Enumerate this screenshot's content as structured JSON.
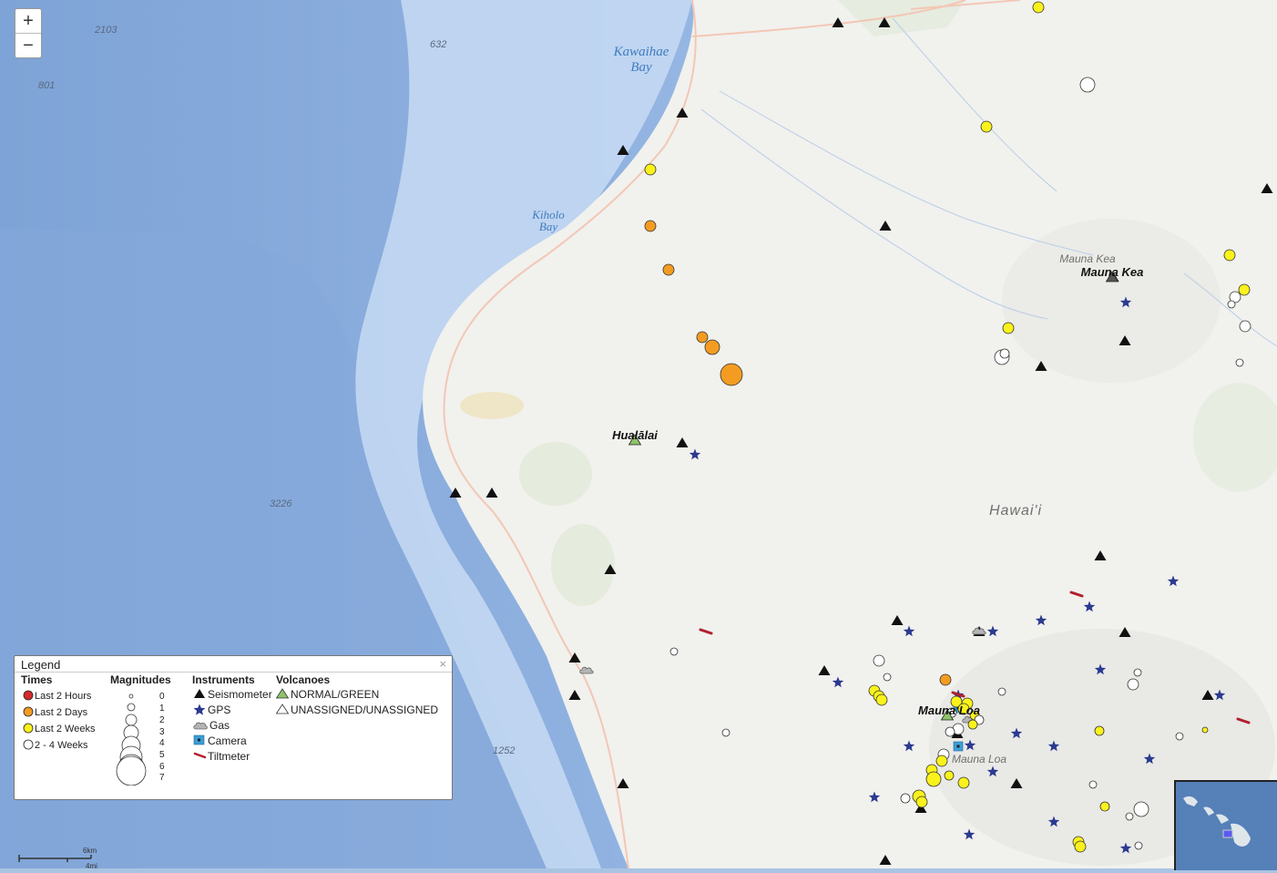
{
  "zoom": {
    "in_label": "+",
    "out_label": "−"
  },
  "labels": {
    "depth": [
      "2103",
      "632",
      "801",
      "3226",
      "1252"
    ],
    "kawaihae": [
      "Kawaihae",
      "Bay"
    ],
    "kiholo": [
      "Kiholo",
      "Bay"
    ],
    "mauna_kea_grey": "Mauna Kea",
    "mauna_kea_black": "Mauna Kea",
    "hualalai": "Hualālai",
    "hawaii": "Hawai'i",
    "mauna_loa_black": "Mauna Loa",
    "mauna_loa_grey": "Mauna Loa"
  },
  "legend": {
    "title": "Legend",
    "close": "×",
    "times_header": "Times",
    "times": [
      {
        "label": "Last 2 Hours",
        "color": "#d42a2a"
      },
      {
        "label": "Last 2 Days",
        "color": "#f39c21"
      },
      {
        "label": "Last 2 Weeks",
        "color": "#fbf21b"
      },
      {
        "label": "2 - 4 Weeks",
        "color": "#ffffff"
      }
    ],
    "magnitudes_header": "Magnitudes",
    "magnitudes": [
      "0",
      "1",
      "2",
      "3",
      "4",
      "5",
      "6",
      "7"
    ],
    "instruments_header": "Instruments",
    "instruments": [
      "Seismometer",
      "GPS",
      "Gas",
      "Camera",
      "Tiltmeter"
    ],
    "volcanoes_header": "Volcanoes",
    "volcanoes": [
      "NORMAL/GREEN",
      "UNASSIGNED/UNASSIGNED"
    ]
  },
  "scale": {
    "km": "6km",
    "mi": "4mi"
  },
  "colors": {
    "ocean_deep": "#7ea3d6",
    "ocean_mid": "#a9c4e8",
    "ocean_shelf": "#c9dcf3",
    "land": "#f1f1ee",
    "seismometer": "#111111",
    "gps": "#2b3a8f",
    "tiltmeter": "#b21f2d",
    "camera": "#3b9fd6",
    "volcano_green": "#8ec36a"
  }
}
